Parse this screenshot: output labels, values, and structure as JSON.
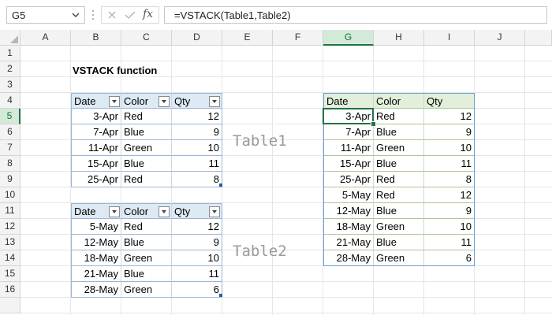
{
  "formula_bar": {
    "name_box": "G5",
    "fx_label": "fx",
    "formula": "=VSTACK(Table1,Table2)"
  },
  "columns": [
    "A",
    "B",
    "C",
    "D",
    "E",
    "F",
    "G",
    "H",
    "I",
    "J"
  ],
  "selected_column": "G",
  "rows": [
    "1",
    "2",
    "3",
    "4",
    "5",
    "6",
    "7",
    "8",
    "9",
    "10",
    "11",
    "12",
    "13",
    "14",
    "15",
    "16"
  ],
  "selected_row": "5",
  "title": "VSTACK function",
  "table1": {
    "label": "Table1",
    "headers": [
      "Date",
      "Color",
      "Qty"
    ],
    "rows": [
      [
        "3-Apr",
        "Red",
        "12"
      ],
      [
        "7-Apr",
        "Blue",
        "9"
      ],
      [
        "11-Apr",
        "Green",
        "10"
      ],
      [
        "15-Apr",
        "Blue",
        "11"
      ],
      [
        "25-Apr",
        "Red",
        "8"
      ]
    ]
  },
  "table2": {
    "label": "Table2",
    "headers": [
      "Date",
      "Color",
      "Qty"
    ],
    "rows": [
      [
        "5-May",
        "Red",
        "12"
      ],
      [
        "12-May",
        "Blue",
        "9"
      ],
      [
        "18-May",
        "Green",
        "10"
      ],
      [
        "21-May",
        "Blue",
        "11"
      ],
      [
        "28-May",
        "Green",
        "6"
      ]
    ]
  },
  "result": {
    "headers": [
      "Date",
      "Color",
      "Qty"
    ],
    "rows": [
      [
        "3-Apr",
        "Red",
        "12"
      ],
      [
        "7-Apr",
        "Blue",
        "9"
      ],
      [
        "11-Apr",
        "Green",
        "10"
      ],
      [
        "15-Apr",
        "Blue",
        "11"
      ],
      [
        "25-Apr",
        "Red",
        "8"
      ],
      [
        "5-May",
        "Red",
        "12"
      ],
      [
        "12-May",
        "Blue",
        "9"
      ],
      [
        "18-May",
        "Green",
        "10"
      ],
      [
        "21-May",
        "Blue",
        "11"
      ],
      [
        "28-May",
        "Green",
        "6"
      ]
    ]
  },
  "colors": {
    "excel_green": "#217346",
    "table_header": "#dde9f3",
    "spill_header": "#e2efda"
  }
}
